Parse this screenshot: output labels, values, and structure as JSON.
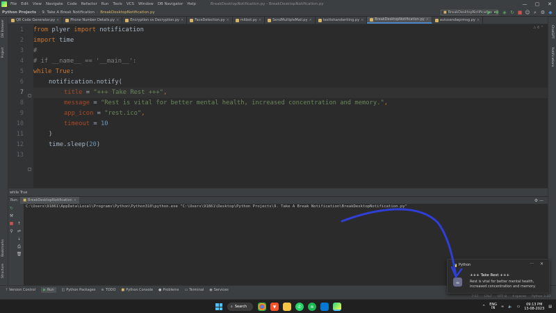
{
  "menubar": {
    "items": [
      "File",
      "Edit",
      "View",
      "Navigate",
      "Code",
      "Refactor",
      "Run",
      "Tools",
      "VCS",
      "Window",
      "DB Navigator",
      "Help"
    ],
    "title": "BreakDesktopNotification.py - BreakDesktopNotification.py"
  },
  "navbar": {
    "project": "Python Projects",
    "folder": "9. Take A Break Notification",
    "file": "BreakDesktopNotification.py",
    "run_config": "BreakDesktopNotification"
  },
  "tabs": [
    {
      "label": "QR Code Generator.py",
      "active": false
    },
    {
      "label": "Phone Number Details.py",
      "active": false
    },
    {
      "label": "Encryption vs Decryption.py",
      "active": false
    },
    {
      "label": "FaceDetection.py",
      "active": false
    },
    {
      "label": "mitbot.py",
      "active": false
    },
    {
      "label": "SendMultipleMail.py",
      "active": false
    },
    {
      "label": "texttohandwriting.py",
      "active": false
    },
    {
      "label": "BreakDesktopNotification.py",
      "active": true
    },
    {
      "label": "autosendwprmsg.py",
      "active": false
    }
  ],
  "left_strip": {
    "db_browser": "DB Browser",
    "project": "Project",
    "bookmarks": "Bookmarks",
    "structure": "Structure"
  },
  "right_strip": {
    "chatgpt": "ChatGPT",
    "notifications": "Notifications"
  },
  "editor": {
    "inspection_badge": "⚠ 6 ^",
    "line_numbers": [
      "1",
      "2",
      "3",
      "4",
      "5",
      "6",
      "7",
      "8",
      "9",
      "10",
      "11",
      "12",
      "13"
    ],
    "current_line": 7,
    "lines": {
      "l1_kw1": "from",
      "l1_mod": " plyer ",
      "l1_kw2": "import",
      "l1_name": " notification",
      "l2_kw": "import",
      "l2_mod": " time",
      "l3_cmt": "#",
      "l4_cmt": "# if __name__ == '__main__':",
      "l5_kw1": "while",
      "l5_kw2": " True",
      "l5_colon": ":",
      "l6_call": "notification.notify(",
      "l7_param": "title",
      "l7_eq": " = ",
      "l7_str": "\"+++ Take Rest +++\"",
      "l7_comma": ",",
      "l8_param": "message",
      "l8_eq": " = ",
      "l8_str": "\"Rest is vital for better mental health, increased concentration and memory.\"",
      "l8_comma": ",",
      "l9_param": "app_icon",
      "l9_eq": " = ",
      "l9_str": "\"rest.ico\"",
      "l9_comma": ",",
      "l10_param": "timeout",
      "l10_eq": " = ",
      "l10_num": "10",
      "l11_paren": ")",
      "l12_call": "time.sleep(",
      "l12_num": "20",
      "l12_paren": ")"
    }
  },
  "breadcrumb": "while True",
  "run_panel": {
    "label": "Run:",
    "tab": "BreakDesktopNotification",
    "command": "C:\\Users\\91861\\AppData\\Local\\Programs\\Python\\Python310\\python.exe \"C:\\Users\\91861\\Desktop\\Python Projects\\9. Take A Break Notification\\BreakDesktopNotification.py\""
  },
  "bottom_tools": [
    "Version Control",
    "Run",
    "Python Packages",
    "TODO",
    "Python Console",
    "Problems",
    "Terminal",
    "Services"
  ],
  "statusbar": {
    "position": "7:57",
    "line_sep": "CRLF",
    "encoding": "UTF-8",
    "indent": "4 spaces",
    "interpreter": "Python 3.10"
  },
  "taskbar": {
    "search": "Search",
    "lang_top": "ENG",
    "lang_bottom": "IN",
    "time": "09:13 PM",
    "date": "13-08-2023"
  },
  "toast": {
    "app": "Python",
    "title": "+++ Take Rest +++",
    "message": "Rest is vital for better mental health, increased concentration and memory."
  },
  "colors": {
    "accent": "#4a88c7",
    "keyword": "#cc7832",
    "string": "#6a8759",
    "number": "#6897bb",
    "annotation": "#2f3fd6"
  }
}
